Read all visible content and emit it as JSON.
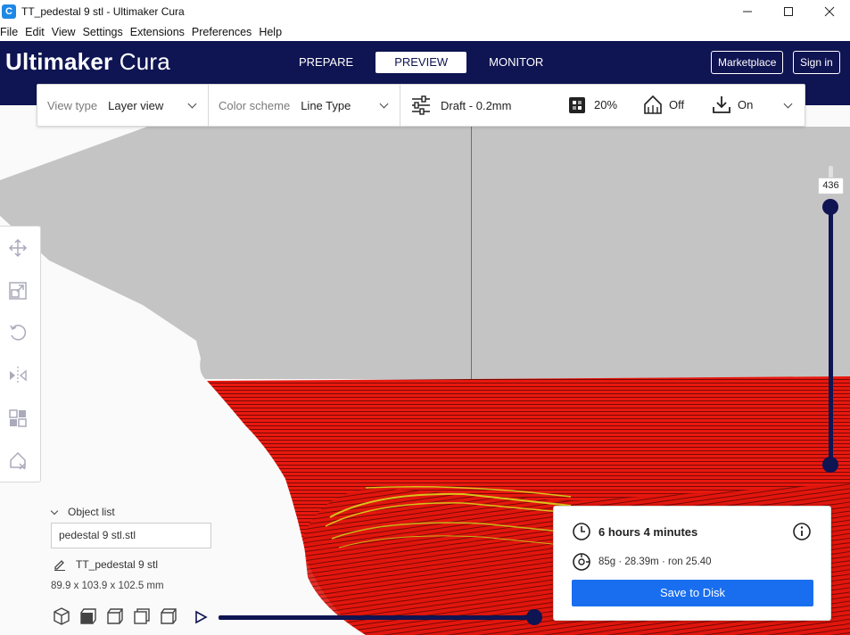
{
  "window": {
    "title": "TT_pedestal 9 stl - Ultimaker Cura",
    "app_icon_glyph": "C"
  },
  "menu": [
    "File",
    "Edit",
    "View",
    "Settings",
    "Extensions",
    "Preferences",
    "Help"
  ],
  "header": {
    "brand": "Ultimaker",
    "product": "Cura",
    "tabs": [
      {
        "label": "PREPARE",
        "active": false
      },
      {
        "label": "PREVIEW",
        "active": true
      },
      {
        "label": "MONITOR",
        "active": false
      }
    ],
    "marketplace_label": "Marketplace",
    "signin_label": "Sign in"
  },
  "toolbar": {
    "view_type_label": "View type",
    "view_type_value": "Layer view",
    "color_scheme_label": "Color scheme",
    "color_scheme_value": "Line Type",
    "profile": "Draft - 0.2mm",
    "infill": "20%",
    "support": "Off",
    "adhesion": "On"
  },
  "layer_slider": {
    "value": "436"
  },
  "object_list": {
    "toggle_label": "Object list",
    "selected": "pedestal 9 stl.stl",
    "object_name": "TT_pedestal 9 stl",
    "dimensions": "89.9 x 103.9 x 102.5 mm"
  },
  "action_panel": {
    "print_time": "6 hours 4 minutes",
    "material": "85g · 28.39m · ron 25.40",
    "save_label": "Save to Disk"
  },
  "colors": {
    "header_bg": "#0f1452",
    "accent": "#196ef0",
    "model_red": "#e8180f",
    "build_volume_gray": "#c4c4c4"
  }
}
